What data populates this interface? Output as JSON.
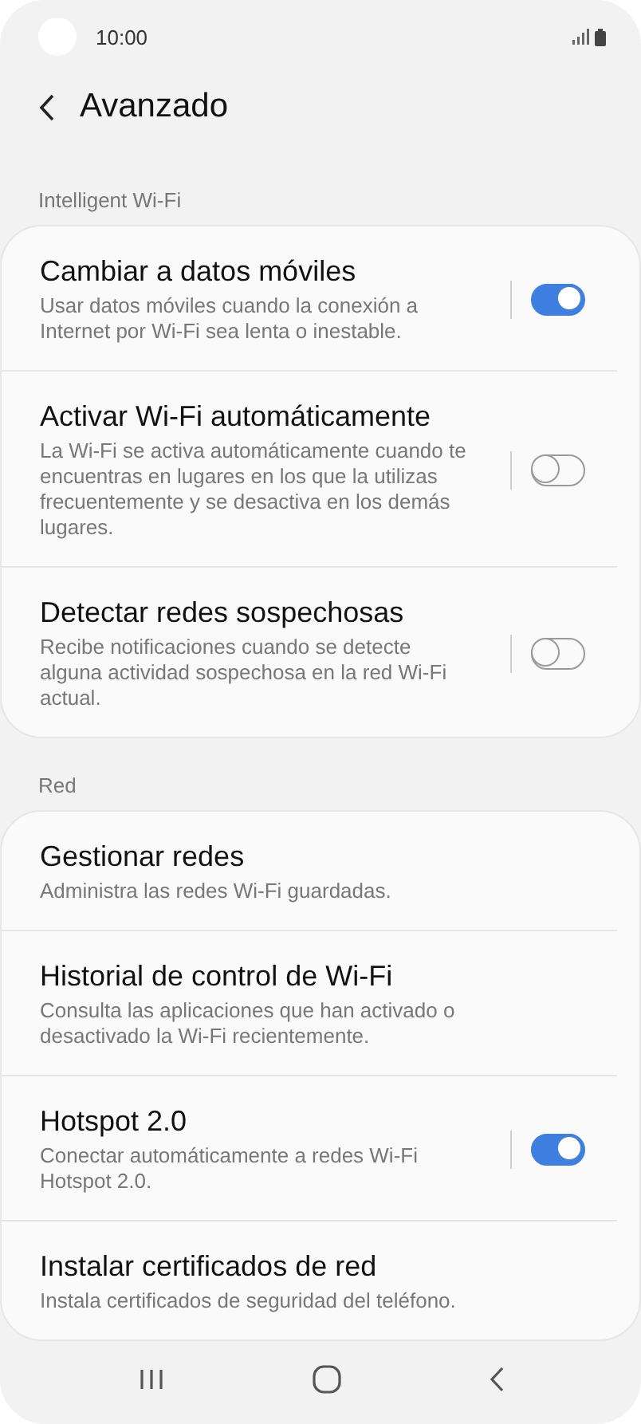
{
  "status_bar": {
    "time": "10:00"
  },
  "header": {
    "title": "Avanzado"
  },
  "sections": [
    {
      "label": "Intelligent Wi-Fi",
      "items": [
        {
          "kind": "toggle",
          "title": "Cambiar a datos móviles",
          "subtitle": "Usar datos móviles cuando la conexión a Internet por Wi-Fi sea lenta o inestable.",
          "on": true
        },
        {
          "kind": "toggle",
          "title": "Activar Wi-Fi automáticamente",
          "subtitle": "La Wi-Fi se activa automáticamente cuando te encuentras en lugares en los que la utilizas frecuentemente y se desactiva en los demás lugares.",
          "on": false
        },
        {
          "kind": "toggle",
          "title": "Detectar redes sospechosas",
          "subtitle": "Recibe notificaciones cuando se detecte alguna actividad sospechosa en la red Wi-Fi actual.",
          "on": false
        }
      ]
    },
    {
      "label": "Red",
      "items": [
        {
          "kind": "link",
          "title": "Gestionar redes",
          "subtitle": "Administra las redes Wi-Fi guardadas."
        },
        {
          "kind": "link",
          "title": "Historial de control de Wi-Fi",
          "subtitle": "Consulta las aplicaciones que han activado o desactivado la Wi-Fi recientemente."
        },
        {
          "kind": "toggle",
          "title": "Hotspot 2.0",
          "subtitle": "Conectar automáticamente a redes Wi-Fi Hotspot 2.0.",
          "on": true
        },
        {
          "kind": "link",
          "title": "Instalar certificados de red",
          "subtitle": "Instala certificados de seguridad del teléfono."
        }
      ]
    }
  ]
}
